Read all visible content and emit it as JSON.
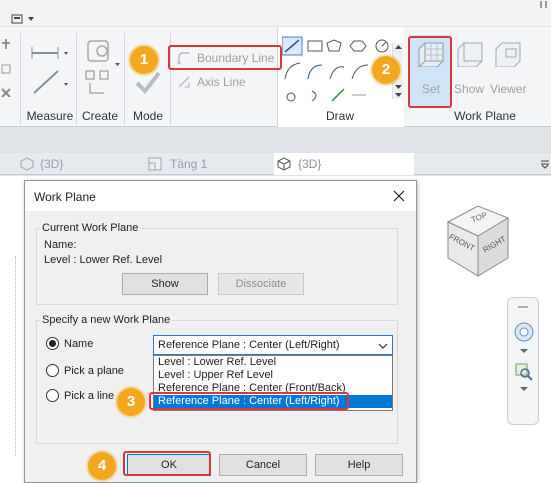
{
  "ribbon": {
    "panels": {
      "measure": "Measure",
      "create": "Create",
      "mode": "Mode",
      "draw": "Draw",
      "work_plane": "Work Plane"
    },
    "boundary_line": "Boundary Line",
    "axis_line": "Axis Line",
    "set": "Set",
    "show": "Show",
    "viewer": "Viewer"
  },
  "view_tabs": [
    {
      "label": "{3D}"
    },
    {
      "label": "Tầng 1"
    },
    {
      "label": "{3D}"
    }
  ],
  "viewcube": {
    "top": "TOP",
    "front": "FRONT",
    "right": "RIGHT"
  },
  "dialog": {
    "title": "Work Plane",
    "current": {
      "legend": "Current Work Plane",
      "name_label": "Name:",
      "name_value": "Level : Lower Ref. Level",
      "show_button": "Show",
      "dissociate_button": "Dissociate"
    },
    "specify": {
      "legend": "Specify a new Work Plane",
      "name_option": "Name",
      "pick_plane_option": "Pick a plane",
      "pick_line_option": "Pick a line",
      "selected_value": "Reference Plane : Center (Left/Right)",
      "options": [
        "Level : Lower Ref. Level",
        "Level : Upper Ref Level",
        "Reference Plane : Center (Front/Back)",
        "Reference Plane : Center (Left/Right)"
      ]
    },
    "ok": "OK",
    "cancel": "Cancel",
    "help": "Help"
  },
  "callouts": [
    "1",
    "2",
    "3",
    "4"
  ],
  "colors": {
    "callout": "#f5a81f",
    "highlight_box": "#d9383a",
    "selection": "#0078d7"
  }
}
